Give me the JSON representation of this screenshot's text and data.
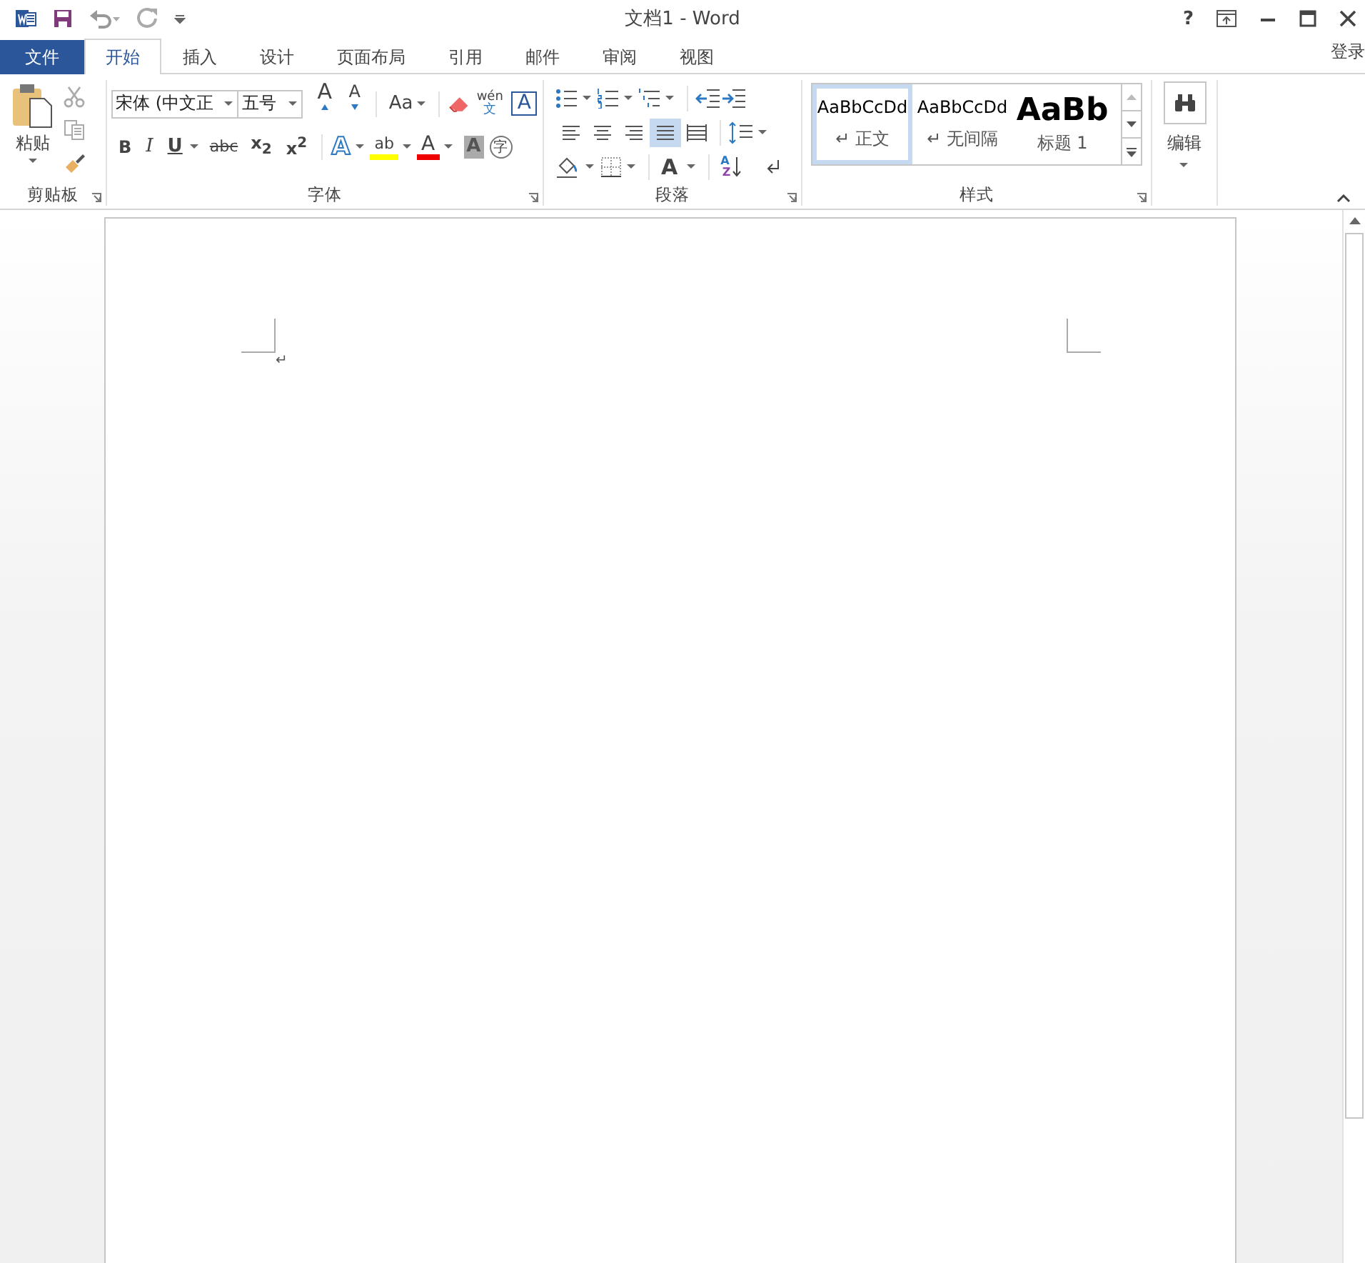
{
  "window": {
    "title": "文档1 - Word",
    "help": "?"
  },
  "tabs": [
    {
      "label": "文件",
      "kind": "file",
      "selected": false
    },
    {
      "label": "开始",
      "kind": "tab",
      "selected": true
    },
    {
      "label": "插入",
      "kind": "tab",
      "selected": false
    },
    {
      "label": "设计",
      "kind": "tab",
      "selected": false
    },
    {
      "label": "页面布局",
      "kind": "tab",
      "selected": false
    },
    {
      "label": "引用",
      "kind": "tab",
      "selected": false
    },
    {
      "label": "邮件",
      "kind": "tab",
      "selected": false
    },
    {
      "label": "审阅",
      "kind": "tab",
      "selected": false
    },
    {
      "label": "视图",
      "kind": "tab",
      "selected": false
    }
  ],
  "account": "登录",
  "clipboard": {
    "title": "剪贴板",
    "paste": "粘贴"
  },
  "font": {
    "title": "字体",
    "font_name": "宋体 (中文正",
    "font_size": "五号",
    "grow": "A",
    "shrink": "A",
    "change_case": "Aa",
    "phonetic": "wén",
    "phonetic_base": "文",
    "char_border": "A",
    "bold": "B",
    "italic": "I",
    "underline": "U",
    "strikethrough": "abc",
    "subscript": "x$_{2}$",
    "superscript": "x$^{2}$",
    "text_effects": "A",
    "highlight": "ab",
    "font_color": "A",
    "char_shading": "A",
    "enclose": "字"
  },
  "paragraph": {
    "title": "段落",
    "alignments": [
      {
        "kind": "left",
        "selected": false
      },
      {
        "kind": "center",
        "selected": false
      },
      {
        "kind": "right",
        "selected": false
      },
      {
        "kind": "justify",
        "selected": true
      },
      {
        "kind": "distributed",
        "selected": false
      }
    ],
    "text_direction": "A",
    "sort_top": "A",
    "sort_bottom": "Z"
  },
  "styles": {
    "title": "样式",
    "items": [
      {
        "preview": "AaBbCcDd",
        "name": "↵ 正文",
        "kind": "normal",
        "selected": true
      },
      {
        "preview": "AaBbCcDd",
        "name": "↵ 无间隔",
        "kind": "normal",
        "selected": false
      },
      {
        "preview": "AaBb",
        "name": "标题 1",
        "kind": "heading",
        "selected": false
      }
    ]
  },
  "editing": {
    "title": "编辑"
  },
  "document": {
    "paragraph_mark": "↵"
  }
}
